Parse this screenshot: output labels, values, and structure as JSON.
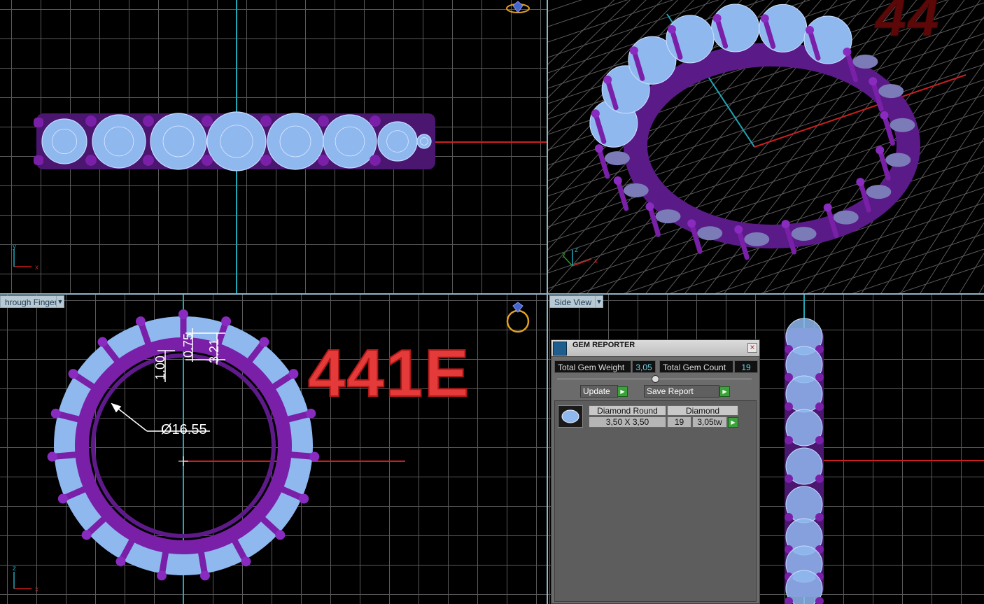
{
  "viewports": {
    "top": {
      "axis_y": "y",
      "axis_x": "x"
    },
    "perspective": {
      "axis_z": "z",
      "axis_y": "y",
      "axis_x": "x",
      "watermark": "44"
    },
    "front": {
      "label": "hrough Finger",
      "axis_z": "z",
      "axis_x": "x",
      "big_label": "441E",
      "diameter": "Ø16.55",
      "dims": [
        "1.00",
        "0.75",
        "3.21"
      ]
    },
    "side": {
      "label": "Side View"
    }
  },
  "gem_reporter": {
    "title": "GEM REPORTER",
    "close": "×",
    "total_weight_label": "Total Gem Weight",
    "total_weight_value": "3,05",
    "total_count_label": "Total Gem Count",
    "total_count_value": "19",
    "update_label": "Update",
    "save_report_label": "Save Report",
    "table": {
      "headers": [
        "Diamond Round",
        "Diamond"
      ],
      "row": {
        "size": "3,50 X 3,50",
        "count": "19",
        "weight": "3,05tw"
      }
    }
  },
  "colors": {
    "metal": "#7a1fa8",
    "gem": "#8fb8ef",
    "axis_x": "#cc1e1e",
    "axis_y": "#20a7b8",
    "grid": "#5a5a5a"
  },
  "icons": [
    "ring-icon",
    "gem-thumbnail-icon",
    "dropdown-arrow-icon",
    "play-arrow-icon",
    "close-icon"
  ]
}
